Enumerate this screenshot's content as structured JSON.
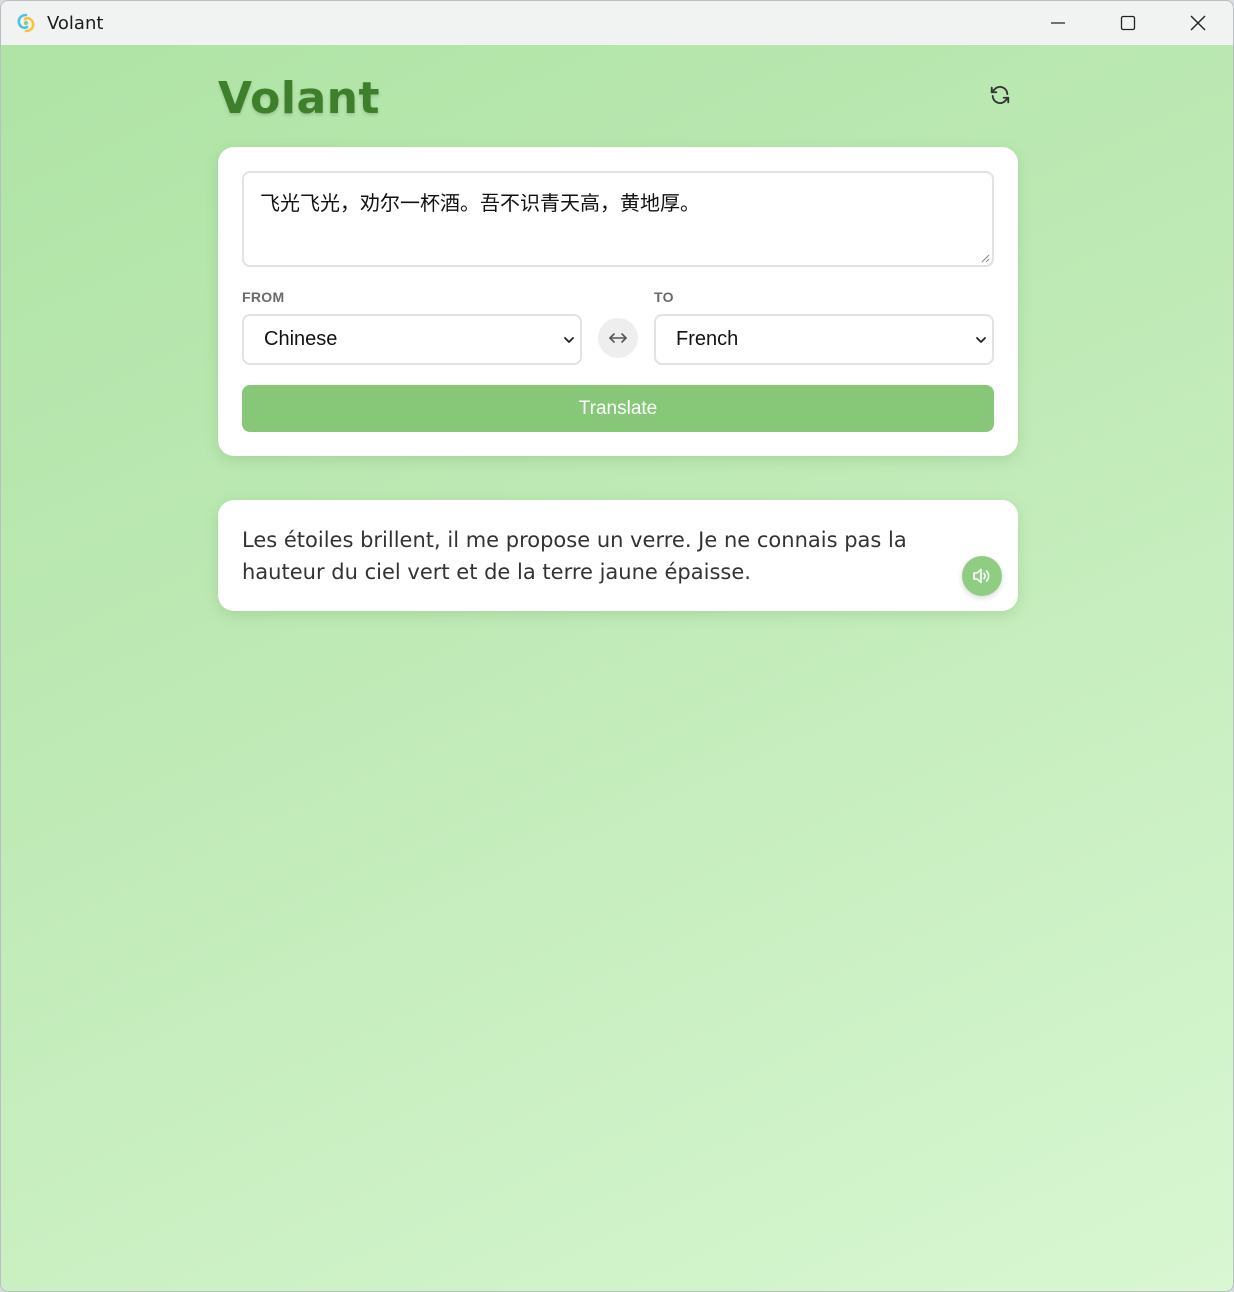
{
  "window": {
    "title": "Volant",
    "controls": [
      "minimize-icon",
      "maximize-icon",
      "close-icon"
    ]
  },
  "header": {
    "title": "Volant",
    "refresh_icon": "refresh-icon"
  },
  "input": {
    "source_text": "飞光飞光，劝尔一杯酒。吾不识青天高，黄地厚。",
    "from_label": "FROM",
    "to_label": "TO",
    "from_language": "Chinese",
    "to_language": "French",
    "swap_icon": "swap-arrows-icon",
    "translate_label": "Translate"
  },
  "output": {
    "translation": "Les étoiles brillent, il me propose un verre. Je ne connais pas la hauteur du ciel vert et de la terre jaune épaisse.",
    "speak_icon": "speaker-icon"
  },
  "colors": {
    "brand_green": "#3e7f2b",
    "button_green": "#87c878",
    "speak_green": "#8fcd82"
  }
}
